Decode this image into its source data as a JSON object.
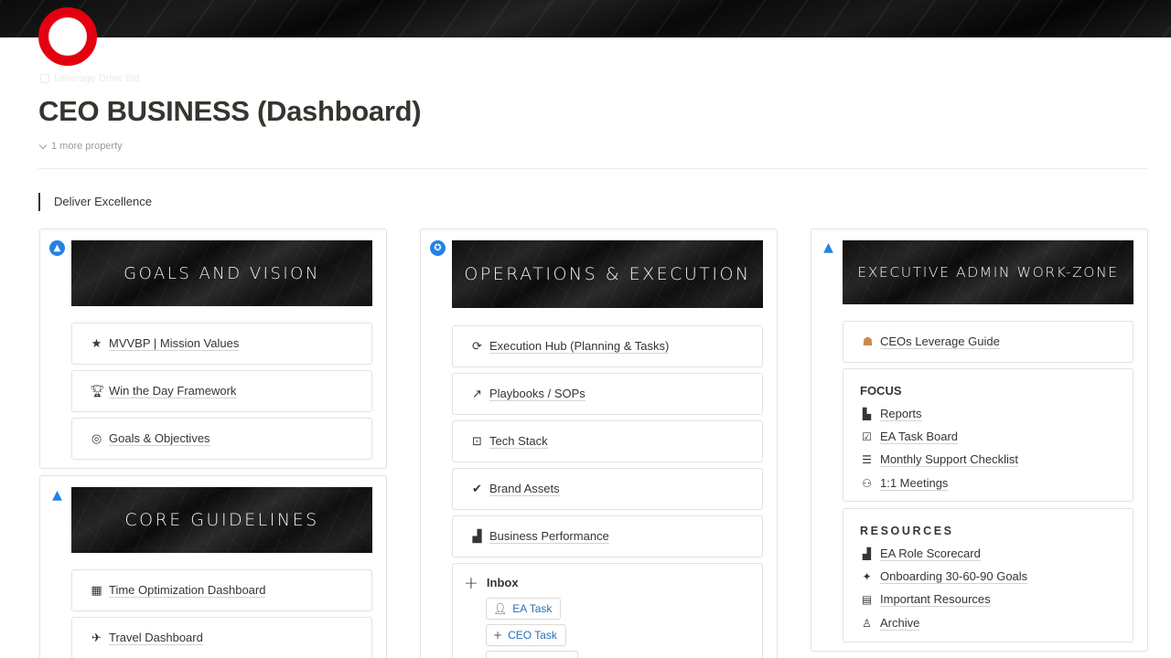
{
  "page": {
    "breadcrumb": "Leverage Drive Bld",
    "title": "CEO BUSINESS (Dashboard)",
    "more_property": "1 more property",
    "quote": "Deliver Excellence"
  },
  "columns": {
    "goals": {
      "banner": "GOALS AND VISION",
      "items": [
        {
          "icon": "star-icon",
          "label": "MVVBP | Mission Values"
        },
        {
          "icon": "trophy-icon",
          "label": "Win the Day Framework"
        },
        {
          "icon": "target-icon",
          "label": "Goals & Objectives"
        }
      ]
    },
    "core": {
      "banner": "CORE GUIDELINES",
      "items": [
        {
          "icon": "calendar-icon",
          "label": "Time Optimization Dashboard"
        },
        {
          "icon": "airplane-icon",
          "label": "Travel Dashboard"
        }
      ]
    },
    "operations": {
      "banner": "OPERATIONS & EXECUTION",
      "items": [
        {
          "icon": "execution-icon",
          "label": "Execution Hub (Planning & Tasks)"
        },
        {
          "icon": "playbook-icon",
          "label": "Playbooks / SOPs"
        },
        {
          "icon": "robot-icon",
          "label": "Tech Stack"
        },
        {
          "icon": "verified-badge-icon",
          "label": "Brand Assets"
        },
        {
          "icon": "chart-icon",
          "label": "Business Performance"
        }
      ],
      "inbox": {
        "title": "Inbox",
        "buttons": [
          {
            "icon": "add-person-icon",
            "label": "EA Task"
          },
          {
            "icon": "plus-icon",
            "label": "CEO Task"
          }
        ]
      }
    },
    "admin": {
      "banner": "EXECUTIVE ADMIN WORK-ZONE",
      "guide": {
        "icon": "person-icon",
        "label": "CEOs Leverage Guide"
      },
      "focus": {
        "title": "FOCUS",
        "items": [
          {
            "icon": "document-icon",
            "label": "Reports"
          },
          {
            "icon": "checkbox-icon",
            "label": "EA Task Board"
          },
          {
            "icon": "checklist-icon",
            "label": "Monthly Support Checklist"
          },
          {
            "icon": "meeting-icon",
            "label": "1:1 Meetings"
          }
        ]
      },
      "resources": {
        "title": "RESOURCES",
        "items": [
          {
            "icon": "bar-chart-icon",
            "label": "EA Role Scorecard"
          },
          {
            "icon": "sparkle-icon",
            "label": "Onboarding 30-60-90 Goals"
          },
          {
            "icon": "archive-box-icon",
            "label": "Important Resources"
          },
          {
            "icon": "walking-person-icon",
            "label": "Archive"
          }
        ]
      }
    }
  },
  "colors": {
    "brand_ring": "#e5000f",
    "accent_blue": "#2383e2",
    "text": "#37352f",
    "link_blue": "#2b6fb6"
  }
}
